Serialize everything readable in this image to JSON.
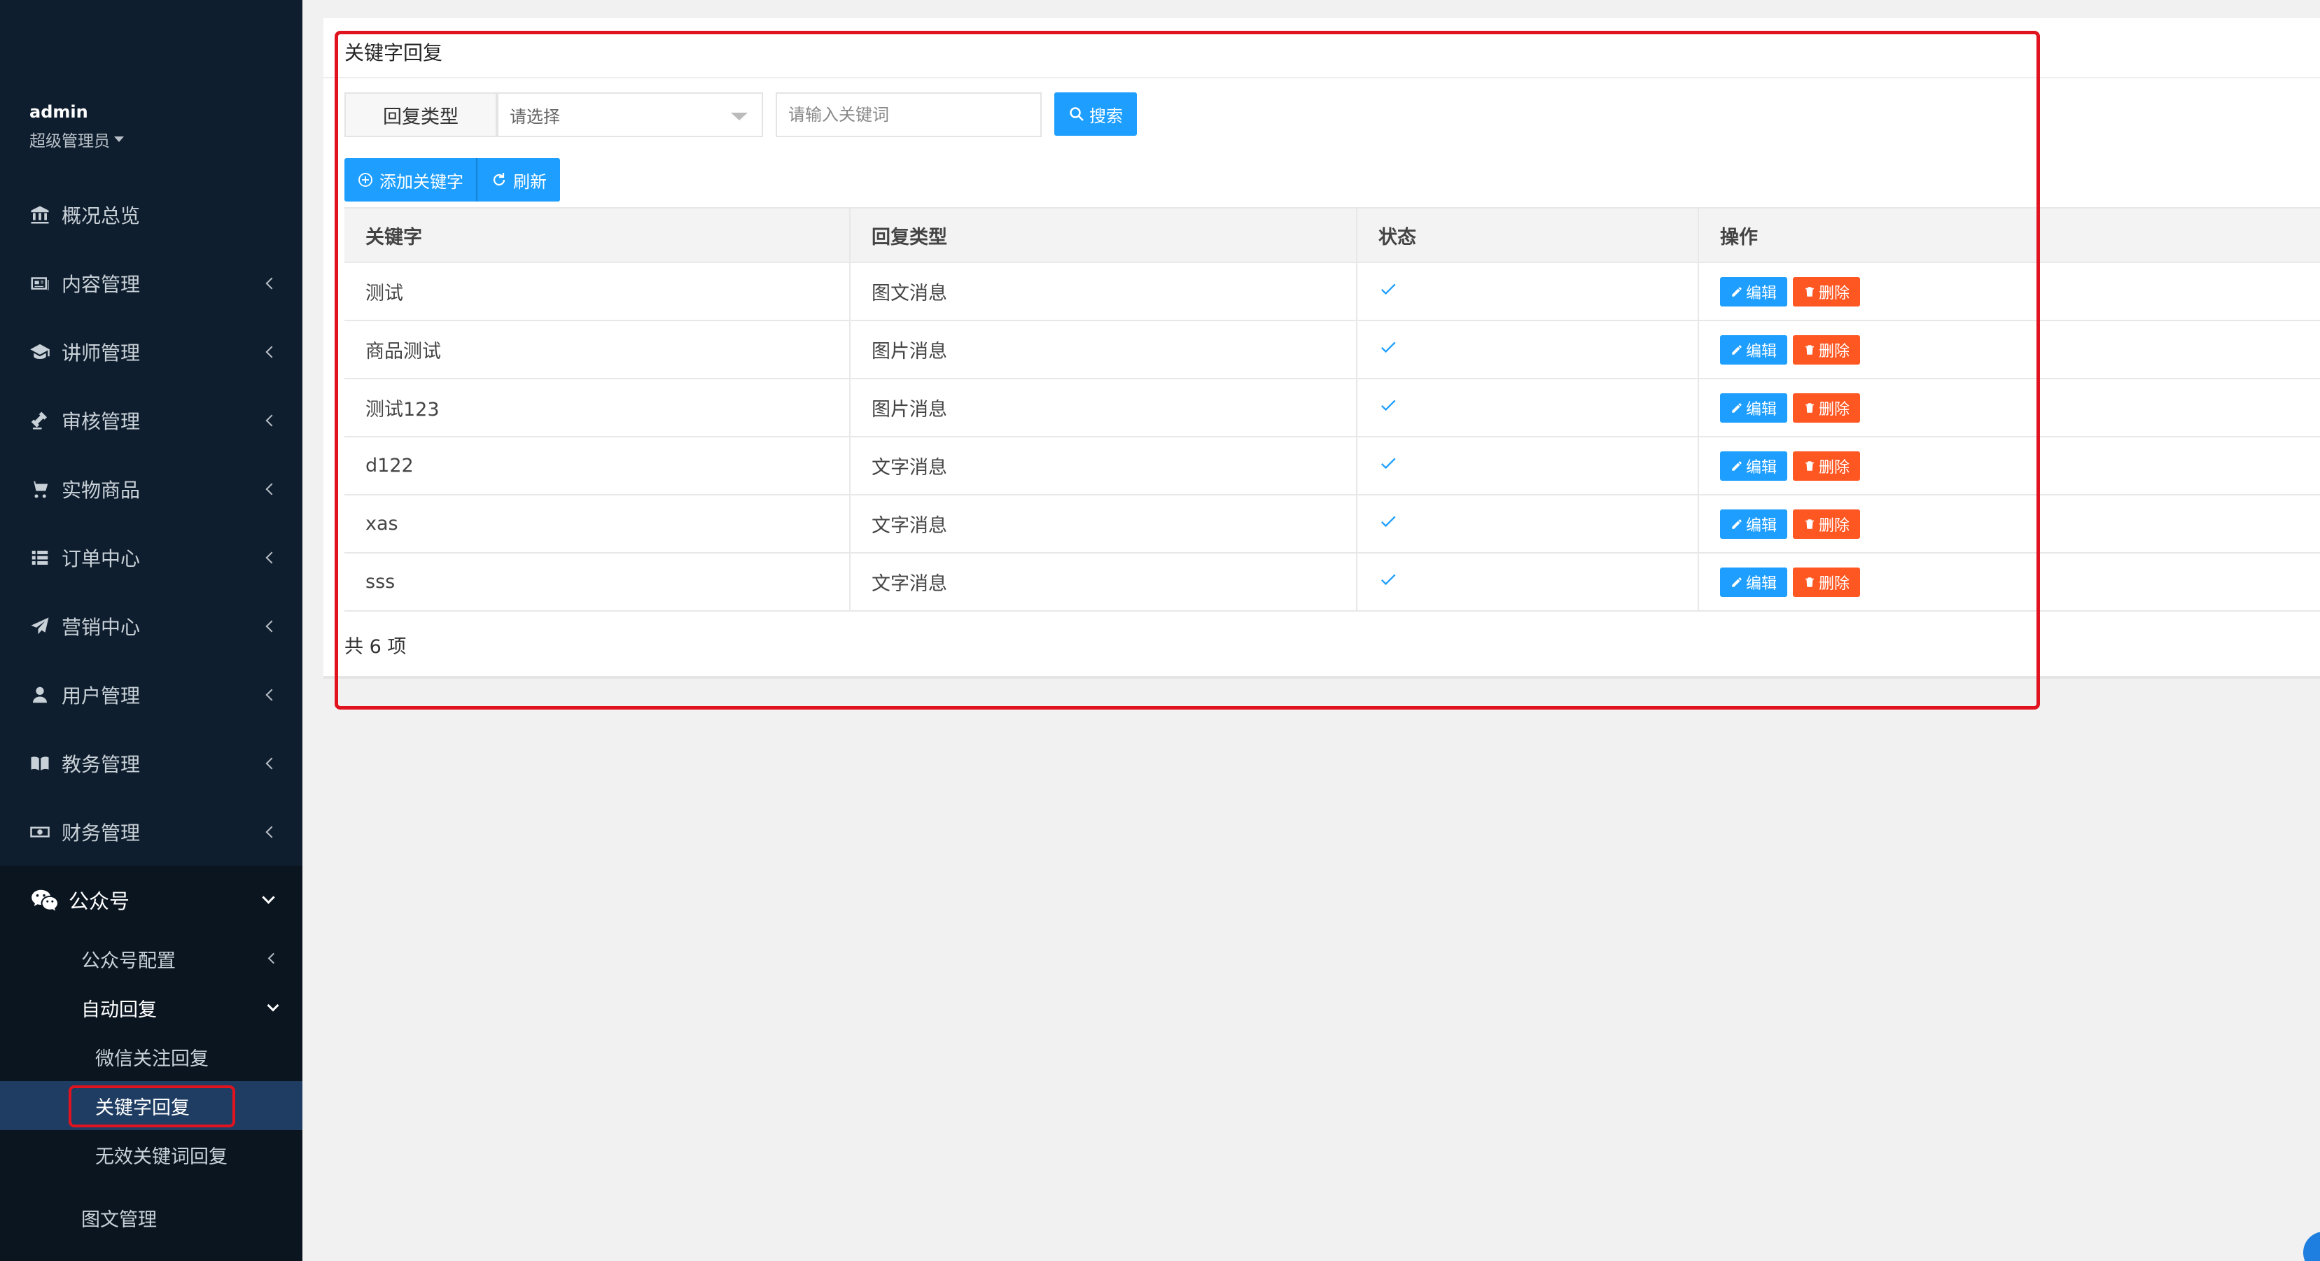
{
  "sidebar": {
    "user": {
      "name": "admin",
      "role": "超级管理员"
    },
    "menu": [
      {
        "label": "概况总览",
        "icon": "bank-icon",
        "has_children": false
      },
      {
        "label": "内容管理",
        "icon": "newspaper-icon",
        "has_children": true
      },
      {
        "label": "讲师管理",
        "icon": "graduation-cap-icon",
        "has_children": true
      },
      {
        "label": "审核管理",
        "icon": "gavel-icon",
        "has_children": true
      },
      {
        "label": "实物商品",
        "icon": "cart-icon",
        "has_children": true
      },
      {
        "label": "订单中心",
        "icon": "list-icon",
        "has_children": true
      },
      {
        "label": "营销中心",
        "icon": "paper-plane-icon",
        "has_children": true
      },
      {
        "label": "用户管理",
        "icon": "user-icon",
        "has_children": true
      },
      {
        "label": "教务管理",
        "icon": "book-icon",
        "has_children": true
      },
      {
        "label": "财务管理",
        "icon": "money-icon",
        "has_children": true
      }
    ],
    "wechat": {
      "label": "公众号",
      "icon": "wechat-icon",
      "children": [
        {
          "label": "公众号配置"
        },
        {
          "label": "自动回复",
          "children": [
            {
              "label": "微信关注回复"
            },
            {
              "label": "关键字回复",
              "active": true
            },
            {
              "label": "无效关键词回复"
            }
          ]
        },
        {
          "label": "图文管理"
        }
      ]
    }
  },
  "main": {
    "title": "关键字回复",
    "filter": {
      "type_label": "回复类型",
      "select_placeholder": "请选择",
      "keyword_placeholder": "请输入关键词",
      "search_label": "搜索"
    },
    "toolbar": {
      "add_label": "添加关键字",
      "refresh_label": "刷新"
    },
    "table": {
      "headers": [
        "关键字",
        "回复类型",
        "状态",
        "操作"
      ],
      "rows": [
        {
          "keyword": "测试",
          "type": "图文消息",
          "status": true
        },
        {
          "keyword": "商品测试",
          "type": "图片消息",
          "status": true
        },
        {
          "keyword": "测试123",
          "type": "图片消息",
          "status": true
        },
        {
          "keyword": "d122",
          "type": "文字消息",
          "status": true
        },
        {
          "keyword": "xas",
          "type": "文字消息",
          "status": true
        },
        {
          "keyword": "sss",
          "type": "文字消息",
          "status": true
        }
      ],
      "edit_label": "编辑",
      "delete_label": "删除"
    },
    "total_text": "共 6 项"
  },
  "colors": {
    "sidebar_bg": "#0f1e2e",
    "primary": "#1e9fff",
    "danger": "#ff5722",
    "highlight": "#e0131f"
  }
}
